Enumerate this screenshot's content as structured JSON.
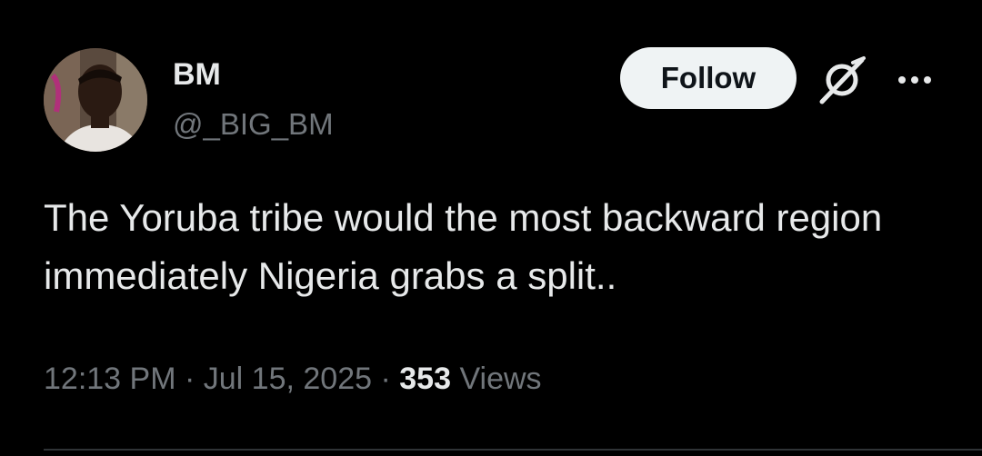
{
  "author": {
    "display_name": "BM",
    "handle": "@_BIG_BM",
    "avatar_icon": "avatar-photo"
  },
  "actions": {
    "follow_label": "Follow",
    "grok_icon": "grok-icon",
    "more_icon": "more-icon"
  },
  "tweet": {
    "text": "The Yoruba tribe would the most backward region immediately Nigeria grabs a split..",
    "time": "12:13 PM",
    "separator": "·",
    "date": "Jul 15, 2025",
    "views_count": "353",
    "views_label": "Views"
  },
  "colors": {
    "background": "#000000",
    "primary_text": "#e7e9ea",
    "secondary_text": "#71767b",
    "follow_bg": "#eff3f4",
    "follow_text": "#0f1419",
    "divider": "#2f3336"
  }
}
